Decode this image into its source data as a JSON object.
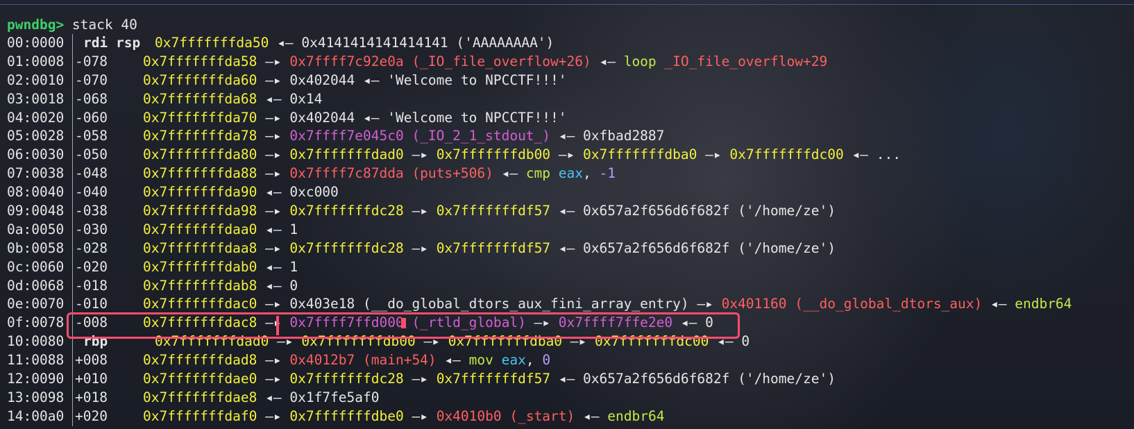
{
  "prompt": {
    "label": "pwndbg>",
    "command": " stack 40"
  },
  "colors": {
    "address": "#f3f03c",
    "code": "#ff5f5f",
    "data": "#d35fd3",
    "asm": "#c6e84a",
    "register": "#4cc3f0",
    "highlight": "#ff4d6d"
  },
  "rows": [
    {
      "idx": "00:0000",
      "reg": "rdi rsp",
      "ofs": "",
      "segs": [
        [
          "addr",
          "0x7fffffffda50"
        ],
        [
          "arrow",
          " ◂— "
        ],
        [
          "text",
          "0x4141414141414141 ('AAAAAAAA')"
        ]
      ]
    },
    {
      "idx": "01:0008",
      "reg": "",
      "ofs": "-078",
      "segs": [
        [
          "addr",
          "0x7fffffffda58"
        ],
        [
          "arrow",
          " —▸ "
        ],
        [
          "code",
          "0x7ffff7c92e0a (_IO_file_overflow+26)"
        ],
        [
          "arrow",
          " ◂— "
        ],
        [
          "asm",
          "loop "
        ],
        [
          "code",
          "_IO_file_overflow+29"
        ]
      ]
    },
    {
      "idx": "02:0010",
      "reg": "",
      "ofs": "-070",
      "segs": [
        [
          "addr",
          "0x7fffffffda60"
        ],
        [
          "arrow",
          " —▸ "
        ],
        [
          "text",
          "0x402044 ◂— 'Welcome to NPCCTF!!!'"
        ]
      ]
    },
    {
      "idx": "03:0018",
      "reg": "",
      "ofs": "-068",
      "segs": [
        [
          "addr",
          "0x7fffffffda68"
        ],
        [
          "arrow",
          " ◂— "
        ],
        [
          "text",
          "0x14"
        ]
      ]
    },
    {
      "idx": "04:0020",
      "reg": "",
      "ofs": "-060",
      "segs": [
        [
          "addr",
          "0x7fffffffda70"
        ],
        [
          "arrow",
          " —▸ "
        ],
        [
          "text",
          "0x402044 ◂— 'Welcome to NPCCTF!!!'"
        ]
      ]
    },
    {
      "idx": "05:0028",
      "reg": "",
      "ofs": "-058",
      "segs": [
        [
          "addr",
          "0x7fffffffda78"
        ],
        [
          "arrow",
          " —▸ "
        ],
        [
          "data",
          "0x7ffff7e045c0 (_IO_2_1_stdout_)"
        ],
        [
          "arrow",
          " ◂— "
        ],
        [
          "text",
          "0xfbad2887"
        ]
      ]
    },
    {
      "idx": "06:0030",
      "reg": "",
      "ofs": "-050",
      "segs": [
        [
          "addr",
          "0x7fffffffda80"
        ],
        [
          "arrow",
          " —▸ "
        ],
        [
          "addr",
          "0x7fffffffdad0"
        ],
        [
          "arrow",
          " —▸ "
        ],
        [
          "addr",
          "0x7fffffffdb00"
        ],
        [
          "arrow",
          " —▸ "
        ],
        [
          "addr",
          "0x7fffffffdba0"
        ],
        [
          "arrow",
          " —▸ "
        ],
        [
          "addr",
          "0x7fffffffdc00"
        ],
        [
          "arrow",
          " ◂— "
        ],
        [
          "text",
          "..."
        ]
      ]
    },
    {
      "idx": "07:0038",
      "reg": "",
      "ofs": "-048",
      "segs": [
        [
          "addr",
          "0x7fffffffda88"
        ],
        [
          "arrow",
          " —▸ "
        ],
        [
          "code",
          "0x7ffff7c87dda (puts+506)"
        ],
        [
          "arrow",
          " ◂— "
        ],
        [
          "asm",
          "cmp "
        ],
        [
          "reg",
          "eax"
        ],
        [
          "text",
          ", "
        ],
        [
          "imm",
          "-1"
        ]
      ]
    },
    {
      "idx": "08:0040",
      "reg": "",
      "ofs": "-040",
      "segs": [
        [
          "addr",
          "0x7fffffffda90"
        ],
        [
          "arrow",
          " ◂— "
        ],
        [
          "text",
          "0xc000"
        ]
      ]
    },
    {
      "idx": "09:0048",
      "reg": "",
      "ofs": "-038",
      "segs": [
        [
          "addr",
          "0x7fffffffda98"
        ],
        [
          "arrow",
          " —▸ "
        ],
        [
          "addr",
          "0x7fffffffdc28"
        ],
        [
          "arrow",
          " —▸ "
        ],
        [
          "addr",
          "0x7fffffffdf57"
        ],
        [
          "arrow",
          " ◂— "
        ],
        [
          "text",
          "0x657a2f656d6f682f ('/home/ze')"
        ]
      ]
    },
    {
      "idx": "0a:0050",
      "reg": "",
      "ofs": "-030",
      "segs": [
        [
          "addr",
          "0x7fffffffdaa0"
        ],
        [
          "arrow",
          " ◂— "
        ],
        [
          "text",
          "1"
        ]
      ]
    },
    {
      "idx": "0b:0058",
      "reg": "",
      "ofs": "-028",
      "segs": [
        [
          "addr",
          "0x7fffffffdaa8"
        ],
        [
          "arrow",
          " —▸ "
        ],
        [
          "addr",
          "0x7fffffffdc28"
        ],
        [
          "arrow",
          " —▸ "
        ],
        [
          "addr",
          "0x7fffffffdf57"
        ],
        [
          "arrow",
          " ◂— "
        ],
        [
          "text",
          "0x657a2f656d6f682f ('/home/ze')"
        ]
      ]
    },
    {
      "idx": "0c:0060",
      "reg": "",
      "ofs": "-020",
      "segs": [
        [
          "addr",
          "0x7fffffffdab0"
        ],
        [
          "arrow",
          " ◂— "
        ],
        [
          "text",
          "1"
        ]
      ]
    },
    {
      "idx": "0d:0068",
      "reg": "",
      "ofs": "-018",
      "segs": [
        [
          "addr",
          "0x7fffffffdab8"
        ],
        [
          "arrow",
          " ◂— "
        ],
        [
          "text",
          "0"
        ]
      ]
    },
    {
      "idx": "0e:0070",
      "reg": "",
      "ofs": "-010",
      "segs": [
        [
          "addr",
          "0x7fffffffdac0"
        ],
        [
          "arrow",
          " —▸ "
        ],
        [
          "text",
          "0x403e18 (__do_global_dtors_aux_fini_array_entry)"
        ],
        [
          "arrow",
          " —▸ "
        ],
        [
          "code",
          "0x401160 (__do_global_dtors_aux)"
        ],
        [
          "arrow",
          " ◂— "
        ],
        [
          "asm",
          "endbr64"
        ]
      ]
    },
    {
      "idx": "0f:0078",
      "reg": "",
      "ofs": "-008",
      "segs": [
        [
          "addr",
          "0x7fffffffdac8"
        ],
        [
          "arrow",
          " —▸ "
        ],
        [
          "data",
          "0x7ffff7ffd000 (_rtld_global)"
        ],
        [
          "arrow",
          " —▸ "
        ],
        [
          "data",
          "0x7ffff7ffe2e0"
        ],
        [
          "arrow",
          " ◂— "
        ],
        [
          "text",
          "0"
        ]
      ]
    },
    {
      "idx": "10:0080",
      "reg": "rbp",
      "ofs": "",
      "segs": [
        [
          "addr",
          "0x7fffffffdad0"
        ],
        [
          "arrow",
          " —▸ "
        ],
        [
          "addr",
          "0x7fffffffdb00"
        ],
        [
          "arrow",
          " —▸ "
        ],
        [
          "addr",
          "0x7fffffffdba0"
        ],
        [
          "arrow",
          " —▸ "
        ],
        [
          "addr",
          "0x7fffffffdc00"
        ],
        [
          "arrow",
          " ◂— "
        ],
        [
          "text",
          "0"
        ]
      ]
    },
    {
      "idx": "11:0088",
      "reg": "",
      "ofs": "+008",
      "segs": [
        [
          "addr",
          "0x7fffffffdad8"
        ],
        [
          "arrow",
          " —▸ "
        ],
        [
          "code",
          "0x4012b7 (main+54)"
        ],
        [
          "arrow",
          " ◂— "
        ],
        [
          "asm",
          "mov "
        ],
        [
          "reg",
          "eax"
        ],
        [
          "text",
          ", "
        ],
        [
          "imm",
          "0"
        ]
      ]
    },
    {
      "idx": "12:0090",
      "reg": "",
      "ofs": "+010",
      "segs": [
        [
          "addr",
          "0x7fffffffdae0"
        ],
        [
          "arrow",
          " —▸ "
        ],
        [
          "addr",
          "0x7fffffffdc28"
        ],
        [
          "arrow",
          " —▸ "
        ],
        [
          "addr",
          "0x7fffffffdf57"
        ],
        [
          "arrow",
          " ◂— "
        ],
        [
          "text",
          "0x657a2f656d6f682f ('/home/ze')"
        ]
      ]
    },
    {
      "idx": "13:0098",
      "reg": "",
      "ofs": "+018",
      "segs": [
        [
          "addr",
          "0x7fffffffdae8"
        ],
        [
          "arrow",
          " ◂— "
        ],
        [
          "text",
          "0x1f7fe5af0"
        ]
      ]
    },
    {
      "idx": "14:00a0",
      "reg": "",
      "ofs": "+020",
      "segs": [
        [
          "addr",
          "0x7fffffffdaf0"
        ],
        [
          "arrow",
          " —▸ "
        ],
        [
          "addr",
          "0x7fffffffdbe0"
        ],
        [
          "arrow",
          " —▸ "
        ],
        [
          "code",
          "0x4010b0 (_start)"
        ],
        [
          "arrow",
          " ◂— "
        ],
        [
          "asm",
          "endbr64"
        ]
      ]
    }
  ]
}
